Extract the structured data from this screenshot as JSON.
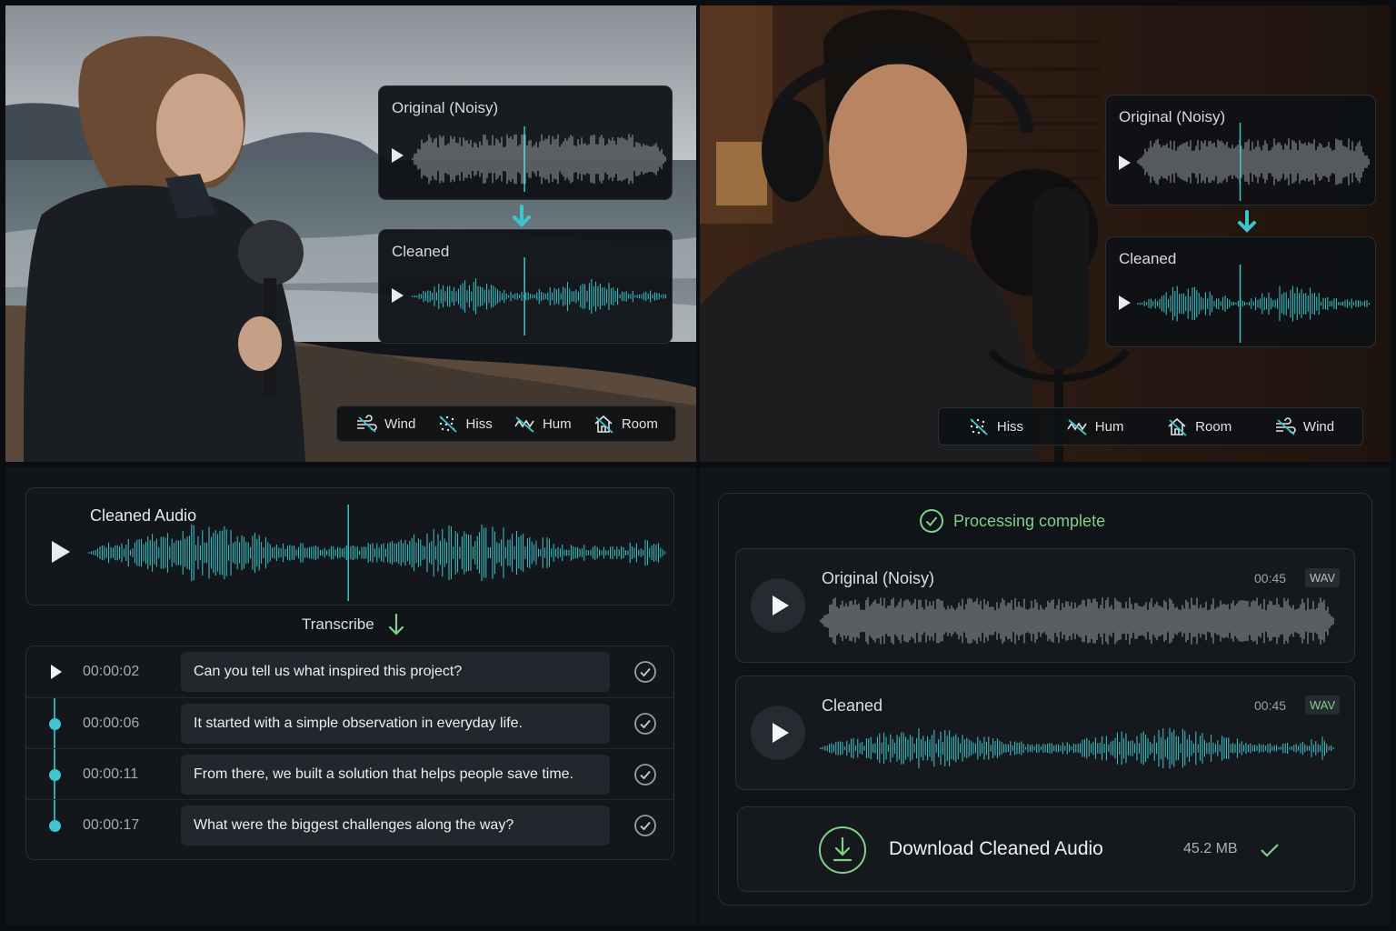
{
  "colors": {
    "accent": "#3ec6cc",
    "success": "#7fd08a",
    "noisy_wave": "#9ea3a8",
    "panel": "#13171b"
  },
  "field_recording": {
    "original": {
      "label": "Original (Noisy)"
    },
    "cleaned": {
      "label": "Cleaned"
    },
    "chips": [
      {
        "label": "Wind",
        "icon": "wind-icon"
      },
      {
        "label": "Hiss",
        "icon": "hiss-icon"
      },
      {
        "label": "Hum",
        "icon": "hum-icon"
      },
      {
        "label": "Room",
        "icon": "room-icon"
      }
    ]
  },
  "studio_recording": {
    "original": {
      "label": "Original (Noisy)"
    },
    "cleaned": {
      "label": "Cleaned"
    },
    "chips": [
      {
        "label": "Hiss",
        "icon": "hiss-icon"
      },
      {
        "label": "Hum",
        "icon": "hum-icon"
      },
      {
        "label": "Room",
        "icon": "room-icon"
      },
      {
        "label": "Wind",
        "icon": "wind-icon"
      }
    ]
  },
  "transcription": {
    "player_title": "Cleaned Audio",
    "transcribe_label": "Transcribe",
    "rows": [
      {
        "time": "00:00:02",
        "text": "Can you tell us what inspired this project?"
      },
      {
        "time": "00:00:06",
        "text": "It started with a simple observation in everyday life."
      },
      {
        "time": "00:00:11",
        "text": "From there, we built a solution that helps people save time."
      },
      {
        "time": "00:00:17",
        "text": "What were the biggest challenges along the way?"
      }
    ]
  },
  "export": {
    "status": "Processing complete",
    "tracks": [
      {
        "title": "Original (Noisy)",
        "duration": "00:45",
        "format": "WAV"
      },
      {
        "title": "Cleaned",
        "duration": "00:45",
        "format": "WAV"
      }
    ],
    "download": {
      "label": "Download Cleaned Audio",
      "size": "45.2 MB"
    }
  }
}
